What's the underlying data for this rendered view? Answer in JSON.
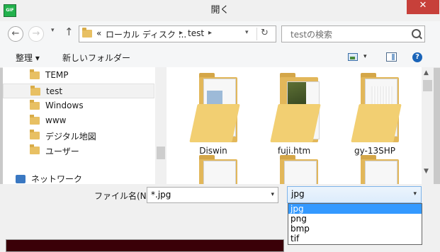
{
  "window": {
    "title": "開く",
    "close_glyph": "✕",
    "app_icon_text": "GIF"
  },
  "nav": {
    "back_glyph": "←",
    "forward_glyph": "→",
    "up_glyph": "↑"
  },
  "address": {
    "crumbs": [
      "«",
      "ローカル ディスク ...",
      "test"
    ],
    "refresh_glyph": "↻"
  },
  "search": {
    "placeholder": "testの検索"
  },
  "toolbar": {
    "organize": "整理 ▾",
    "new_folder": "新しいフォルダー",
    "help_glyph": "?"
  },
  "sidebar": {
    "items": [
      {
        "label": "TEMP",
        "selected": false
      },
      {
        "label": "test",
        "selected": true
      },
      {
        "label": "Windows",
        "selected": false
      },
      {
        "label": "www",
        "selected": false
      },
      {
        "label": "デジタル地図",
        "selected": false
      },
      {
        "label": "ユーザー",
        "selected": false
      }
    ],
    "network_label": "ネットワーク"
  },
  "files": {
    "items": [
      "Diswin",
      "fuji.htm",
      "gy-13SHP",
      "",
      "",
      ""
    ]
  },
  "bottom": {
    "filename_label": "ファイル名(N):",
    "filename_value": "*.jpg",
    "filetype_value": "jpg",
    "filetype_options": [
      "jpg",
      "png",
      "bmp",
      "tif"
    ],
    "filetype_selected_index": 0
  },
  "colors": {
    "close": "#c7403a",
    "selection": "#3399ff",
    "folder": "#e8c063"
  }
}
